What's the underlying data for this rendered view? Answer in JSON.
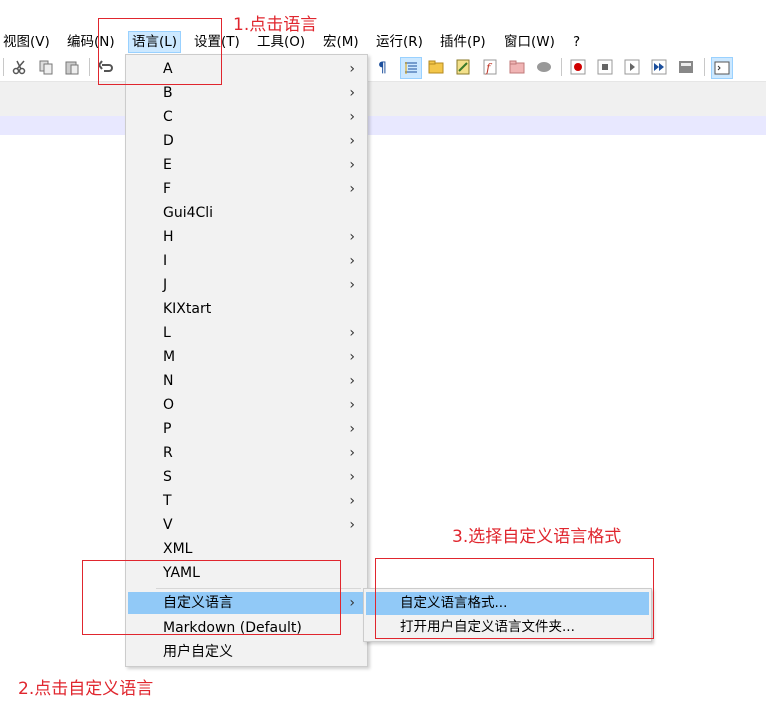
{
  "menubar": [
    "视图(V)",
    "编码(N)",
    "语言(L)",
    "设置(T)",
    "工具(O)",
    "宏(M)",
    "运行(R)",
    "插件(P)",
    "窗口(W)",
    "?"
  ],
  "language_menu": {
    "items": [
      {
        "label": "A",
        "submenu": true
      },
      {
        "label": "B",
        "submenu": true
      },
      {
        "label": "C",
        "submenu": true
      },
      {
        "label": "D",
        "submenu": true
      },
      {
        "label": "E",
        "submenu": true
      },
      {
        "label": "F",
        "submenu": true
      },
      {
        "label": "Gui4Cli",
        "submenu": false
      },
      {
        "label": "H",
        "submenu": true
      },
      {
        "label": "I",
        "submenu": true
      },
      {
        "label": "J",
        "submenu": true
      },
      {
        "label": "KIXtart",
        "submenu": false
      },
      {
        "label": "L",
        "submenu": true
      },
      {
        "label": "M",
        "submenu": true
      },
      {
        "label": "N",
        "submenu": true
      },
      {
        "label": "O",
        "submenu": true
      },
      {
        "label": "P",
        "submenu": true
      },
      {
        "label": "R",
        "submenu": true
      },
      {
        "label": "S",
        "submenu": true
      },
      {
        "label": "T",
        "submenu": true
      },
      {
        "label": "V",
        "submenu": true
      },
      {
        "label": "XML",
        "submenu": false
      },
      {
        "label": "YAML",
        "submenu": false
      },
      {
        "label": "自定义语言",
        "submenu": true,
        "highlighted": true
      },
      {
        "label": "Markdown (Default)",
        "submenu": false
      },
      {
        "label": "用户自定义",
        "submenu": false
      }
    ]
  },
  "custom_language_submenu": {
    "items": [
      "自定义语言格式...",
      "打开用户自定义语言文件夹..."
    ]
  },
  "annotations": {
    "step1": "1.点击语言",
    "step2": "2.点击自定义语言",
    "step3": "3.选择自定义语言格式"
  },
  "colors": {
    "annotation": "#e0262e",
    "menu_highlight": "#91c9f7",
    "menubar_active": "#cce8ff"
  }
}
